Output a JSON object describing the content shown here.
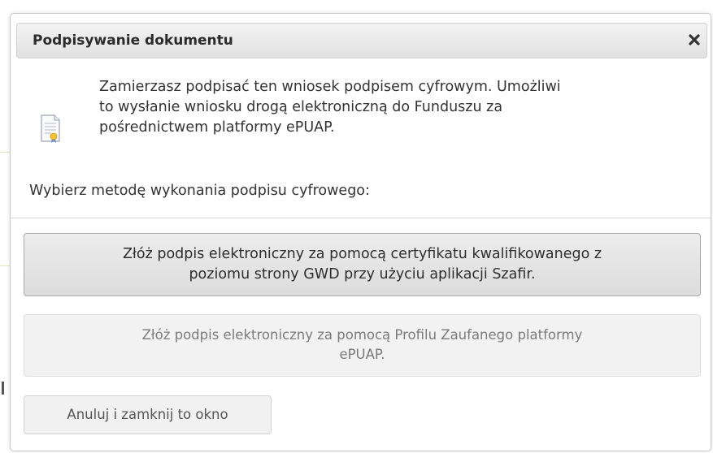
{
  "dialog": {
    "title": "Podpisywanie dokumentu",
    "close_icon": "close-icon",
    "info_icon": "certificate-document-icon",
    "info_lines": [
      "Zamierzasz podpisać ten wniosek podpisem cyfrowym. Umożliwi",
      "to wysłanie wniosku drogą elektroniczną do Funduszu za",
      "pośrednictwem platformy ePUAP."
    ],
    "prompt": "Wybierz metodę wykonania podpisu cyfrowego:",
    "buttons": {
      "szafir": {
        "lines": [
          "Złóż podpis elektroniczny za pomocą certyfikatu kwalifikowanego z",
          "poziomu strony GWD przy użyciu aplikacji Szafir."
        ]
      },
      "epuap": {
        "lines": [
          "Złóż podpis elektroniczny za pomocą Profilu Zaufanego platformy",
          "ePUAP."
        ],
        "disabled": true
      },
      "cancel": {
        "label": "Anuluj i zamknij to okno"
      }
    }
  },
  "colors": {
    "title_text": "#2b2b2b",
    "body_text": "#333333",
    "disabled_text": "#7b7b7b",
    "titlebar_bg": "#e1e1e1"
  }
}
